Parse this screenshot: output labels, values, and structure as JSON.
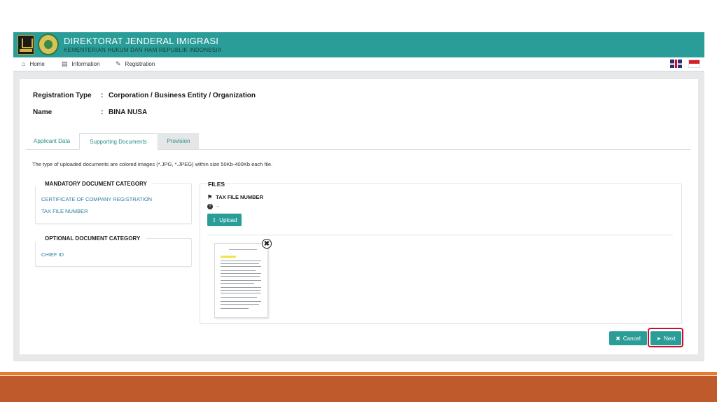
{
  "header": {
    "title": "DIREKTORAT JENDERAL IMIGRASI",
    "subtitle": "KEMENTERIAN HUKUM DAN HAM REPUBLIK INDONESIA"
  },
  "nav": {
    "items": [
      {
        "label": "Home",
        "icon": "home-icon"
      },
      {
        "label": "Information",
        "icon": "book-icon"
      },
      {
        "label": "Registration",
        "icon": "pencil-icon"
      }
    ],
    "languages": [
      "en-flag-icon",
      "id-flag-icon"
    ]
  },
  "registration": {
    "type_label": "Registration Type",
    "type_value": "Corporation / Business Entity / Organization",
    "name_label": "Name",
    "name_value": "BINA NUSA",
    "colon": ":"
  },
  "tabs": [
    {
      "label": "Applicant Data",
      "active": false
    },
    {
      "label": "Supporting Documents",
      "active": true
    },
    {
      "label": "Provision",
      "active": false
    }
  ],
  "note": "The type of uploaded documents are colored images (*.JPG, *.JPEG) within size 50Kb-400Kb each file.",
  "mandatory": {
    "title": "MANDATORY DOCUMENT CATEGORY",
    "items": [
      "CERTIFICATE OF COMPANY REGISTRATION",
      "TAX FILE NUMBER"
    ]
  },
  "optional": {
    "title": "OPTIONAL DOCUMENT CATEGORY",
    "items": [
      "CHIEF ID"
    ]
  },
  "files": {
    "title": "FILES",
    "selected_doc": "TAX FILE NUMBER",
    "info": "-",
    "upload_label": "Upload"
  },
  "actions": {
    "cancel_label": "Cancel",
    "next_label": "Next"
  },
  "colors": {
    "teal": "#2a9d98",
    "orange": "#e87a2d",
    "rust": "#bf5a2d",
    "highlight": "#c8102e"
  }
}
